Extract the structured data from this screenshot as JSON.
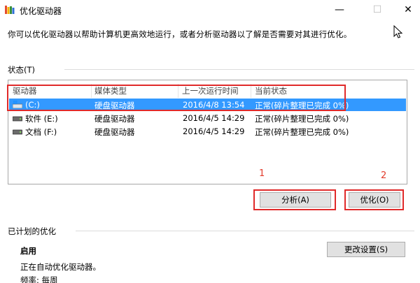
{
  "window": {
    "title": "优化驱动器",
    "min_glyph": "—",
    "max_glyph": "☐",
    "close_glyph": "✕"
  },
  "description": "你可以优化驱动器以帮助计算机更高效地运行，或者分析驱动器以了解是否需要对其进行优化。",
  "status_group": {
    "label": "状态(T)"
  },
  "columns": [
    "驱动器",
    "媒体类型",
    "上一次运行时间",
    "当前状态"
  ],
  "drives": [
    {
      "name": "(C:)",
      "media": "硬盘驱动器",
      "last_run": "2016/4/8 13:54",
      "status": "正常(碎片整理已完成 0%)",
      "selected": true,
      "icon": "windows-drive-icon"
    },
    {
      "name": "软件 (E:)",
      "media": "硬盘驱动器",
      "last_run": "2016/4/5 14:29",
      "status": "正常(碎片整理已完成 0%)",
      "selected": false,
      "icon": "hard-drive-icon"
    },
    {
      "name": "文档 (F:)",
      "media": "硬盘驱动器",
      "last_run": "2016/4/5 14:29",
      "status": "正常(碎片整理已完成 0%)",
      "selected": false,
      "icon": "hard-drive-icon"
    }
  ],
  "annotations": {
    "marker_1": "1",
    "marker_2": "2"
  },
  "buttons": {
    "analyze": "分析(A)",
    "optimize": "优化(O)",
    "change_settings": "更改设置(S)"
  },
  "scheduled": {
    "label": "已计划的优化",
    "status": "启用",
    "description": "正在自动优化驱动器。",
    "frequency": "频率: 每周"
  },
  "colors": {
    "selection": "#3399ff",
    "annotation_red": "#e02a2a",
    "button_face": "#e1e1e1"
  }
}
